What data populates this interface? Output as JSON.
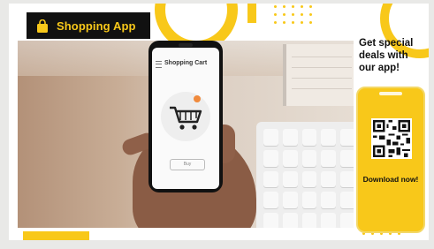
{
  "brand": {
    "name": "Shopping App",
    "icon": "shopping-bag-icon"
  },
  "phone_screen": {
    "title": "Shopping Cart",
    "button": "Buy"
  },
  "promo": {
    "headline": "Get special deals with our app!"
  },
  "cta": {
    "label": "Download now!"
  },
  "colors": {
    "accent": "#f8c81a",
    "dark": "#111111",
    "background": "#ffffff"
  }
}
